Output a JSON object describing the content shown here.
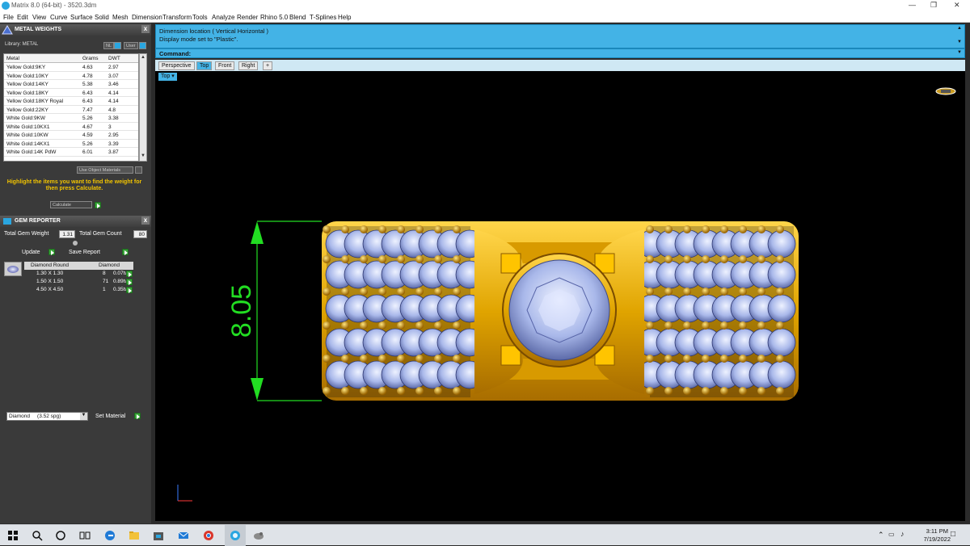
{
  "window": {
    "title": "Matrix 8.0 (64-bit) - 3520.3dm",
    "min_icon": "minimize-icon",
    "max_icon": "maximize-icon",
    "close_icon": "close-icon"
  },
  "menu": [
    "File",
    "Edit",
    "View",
    "Curve",
    "Surface",
    "Solid",
    "Mesh",
    "Dimension",
    "Transform",
    "Tools",
    "Analyze",
    "Render",
    "Rhino 5.0",
    "Blend",
    "T-Splines",
    "Help"
  ],
  "metal_weights": {
    "title": "METAL WEIGHTS",
    "library_label": "Library: METAL",
    "btn_nl": "NL",
    "btn_user": "User",
    "columns": [
      "Metal",
      "Grams",
      "DWT"
    ],
    "rows": [
      [
        "Yellow Gold:9KY",
        "4.63",
        "2.97"
      ],
      [
        "Yellow Gold:10KY",
        "4.78",
        "3.07"
      ],
      [
        "Yellow Gold:14KY",
        "5.38",
        "3.46"
      ],
      [
        "Yellow Gold:18KY",
        "6.43",
        "4.14"
      ],
      [
        "Yellow Gold:18KY Royal",
        "6.43",
        "4.14"
      ],
      [
        "Yellow Gold:22KY",
        "7.47",
        "4.8"
      ],
      [
        "White Gold:9KW",
        "5.26",
        "3.38"
      ],
      [
        "White Gold:10KX1",
        "4.67",
        "3"
      ],
      [
        "White Gold:10KW",
        "4.59",
        "2.95"
      ],
      [
        "White Gold:14KX1",
        "5.26",
        "3.39"
      ],
      [
        "White Gold:14K PdW",
        "6.01",
        "3.87"
      ]
    ],
    "use_object_materials": "Use Object Materials",
    "hint": "Highlight the items you want to find the weight for then press Calculate.",
    "calculate": "Calculate"
  },
  "gem_reporter": {
    "title": "GEM REPORTER",
    "total_weight_label": "Total Gem Weight",
    "total_weight": "1.31",
    "total_count_label": "Total Gem Count",
    "total_count": "80",
    "update": "Update",
    "save_report": "Save Report",
    "columns": [
      "Diamond Round",
      "Diamond"
    ],
    "rows": [
      [
        "1.30 X 1.30",
        "8",
        "0.07tw"
      ],
      [
        "1.50 X 1.50",
        "71",
        "0.89tw"
      ],
      [
        "4.50 X 4.50",
        "1",
        "0.35tw"
      ]
    ],
    "material_select": "Diamond     (3.52 spg)",
    "set_material": "Set Material"
  },
  "command": {
    "history_1": "Dimension location ( Vertical  Horizontal )",
    "history_2": "Display mode set to \"Plastic\".",
    "prompt": "Command:"
  },
  "viewport_tabs": [
    "Perspective",
    "Top",
    "Front",
    "Right",
    "+"
  ],
  "viewport": {
    "label": "Top",
    "dimension": "8.05"
  },
  "taskbar": {
    "icons": [
      "windows-start-icon",
      "search-icon",
      "cortana-icon",
      "task-view-icon",
      "edge-icon",
      "file-explorer-icon",
      "store-icon",
      "mail-icon",
      "chrome-icon",
      "matrix-app-icon",
      "rhino-icon"
    ],
    "time": "3:11 PM",
    "date": "7/19/2022"
  }
}
